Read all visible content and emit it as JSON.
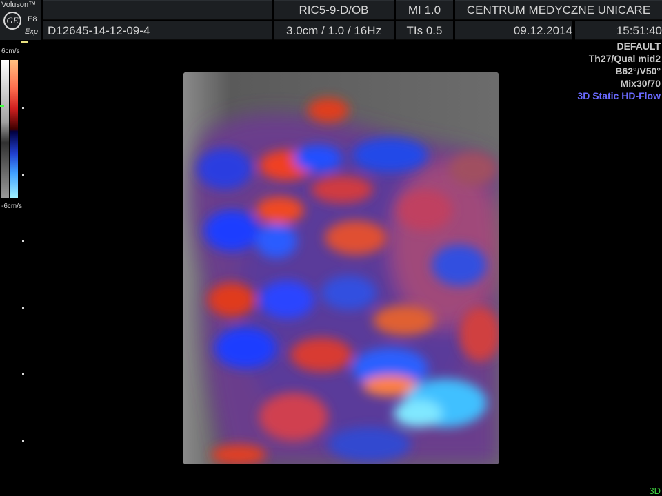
{
  "header": {
    "brand": {
      "name": "Voluson™",
      "model": "E8",
      "edition": "Exp",
      "logo_text": "GE"
    },
    "patient_id": "D12645-14-12-09-4",
    "probe": "RIC5-9-D/OB",
    "depth_info": "3.0cm / 1.0 / 16Hz",
    "mi": "MI  1.0",
    "tis": "TIs  0.5",
    "institution": "CENTRUM MEDYCZNE UNICARE",
    "date": "09.12.2014",
    "time": "15:51:40"
  },
  "params": {
    "preset": "DEFAULT",
    "quality": "Th27/Qual mid2",
    "angles": "B62°/V50°",
    "mix": "Mix30/70",
    "mode": "3D Static HD-Flow"
  },
  "scale": {
    "top_label": "6cm/s",
    "bottom_label": "-6cm/s"
  },
  "footer": {
    "view_mode": "3D"
  },
  "colors": {
    "header_bg": "#1c1f22",
    "mode_text": "#6a6aff",
    "flow_red": "#e03c1e",
    "flow_blue": "#1e3cff",
    "flow_cyan": "#40d0ff"
  },
  "icons": [
    "ge-logo-icon"
  ]
}
